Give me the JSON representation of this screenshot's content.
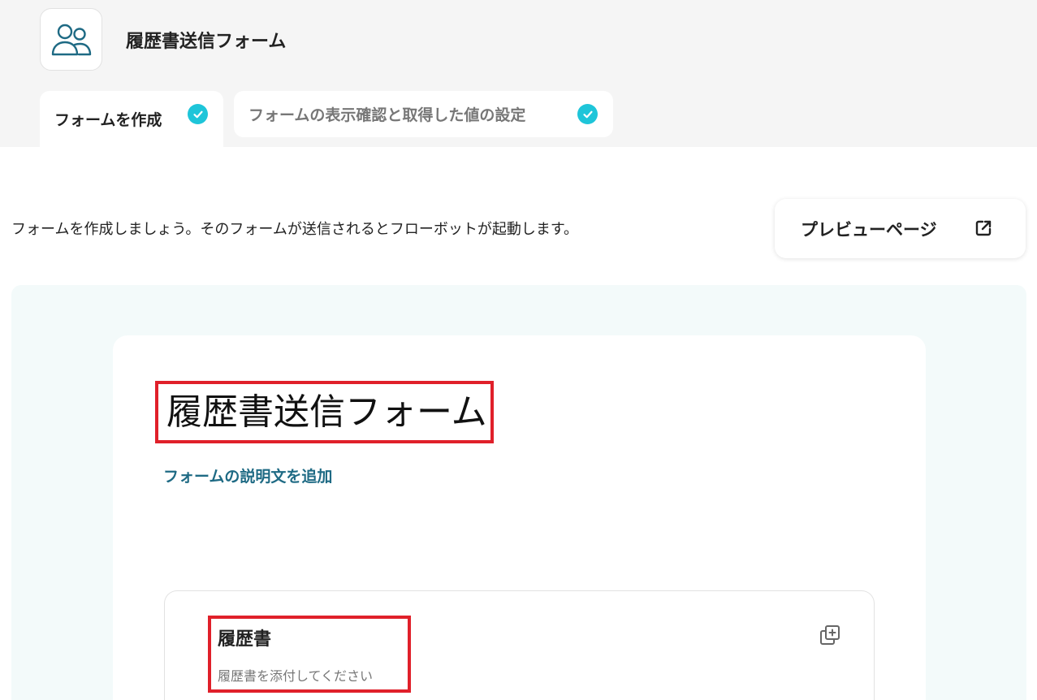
{
  "header": {
    "app_icon": "users-icon",
    "title": "履歴書送信フォーム"
  },
  "tabs": [
    {
      "label": "フォームを作成",
      "status": "completed",
      "active": true
    },
    {
      "label": "フォームの表示確認と取得した値の設定",
      "status": "completed",
      "active": false
    }
  ],
  "intro": {
    "text": "フォームを作成しましょう。そのフォームが送信されるとフローボットが起動します。"
  },
  "preview_button": {
    "label": "プレビューページ",
    "icon": "external-link-icon"
  },
  "form": {
    "title": "履歴書送信フォーム",
    "add_description_label": "フォームの説明文を追加",
    "fields": [
      {
        "label": "履歴書",
        "help_text": "履歴書を添付してください",
        "action_icon": "duplicate-icon"
      }
    ]
  },
  "colors": {
    "accent": "#1ec5d9",
    "link": "#1e6a84",
    "highlight": "#e0202a",
    "canvas_bg": "#f3fafa",
    "top_bg": "#f5f5f5"
  }
}
